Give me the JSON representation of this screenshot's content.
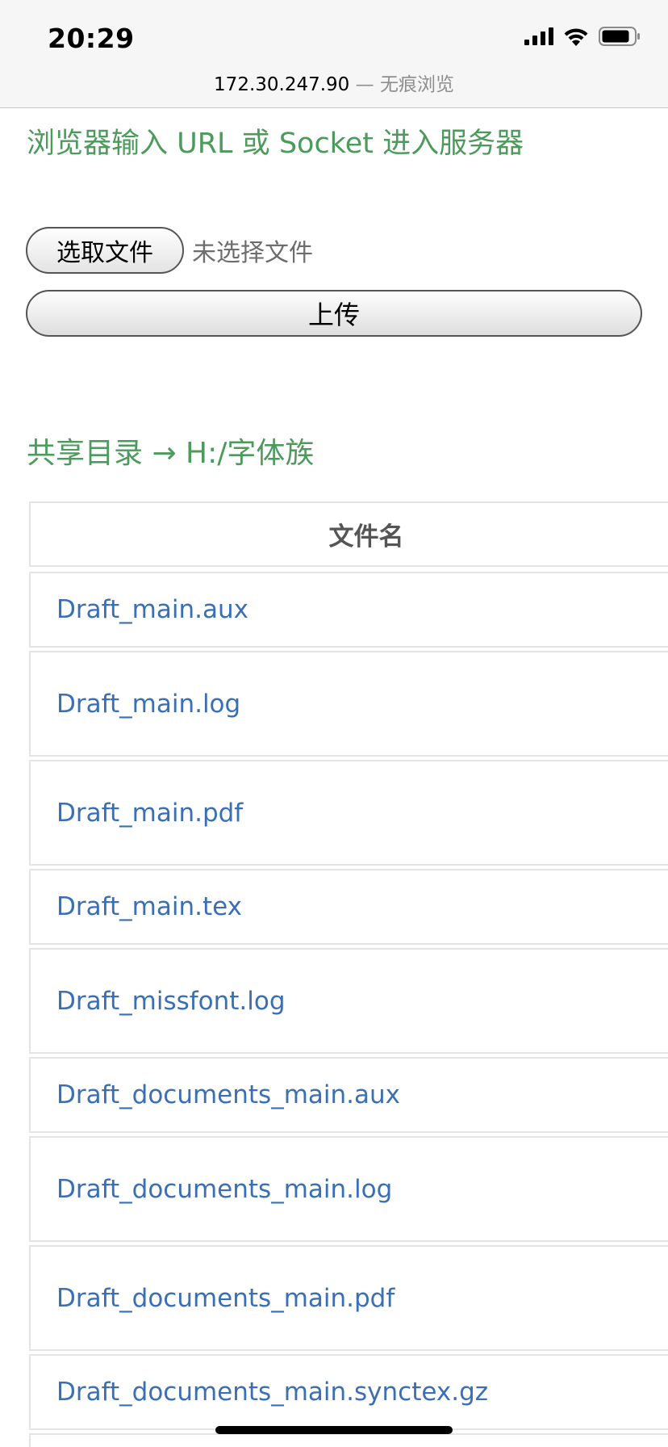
{
  "status_bar": {
    "time": "20:29"
  },
  "address_bar": {
    "host": "172.30.247.90",
    "separator": " — ",
    "mode": "无痕浏览"
  },
  "page": {
    "entry_hint": "浏览器输入 URL 或 Socket 进入服务器",
    "choose_file_label": "选取文件",
    "no_file_text": "未选择文件",
    "upload_label": "上传",
    "share_path": "共享目录 → H:/字体族",
    "table_header": "文件名",
    "files": [
      "Draft_main.aux",
      "Draft_main.log",
      "Draft_main.pdf",
      "Draft_main.tex",
      "Draft_missfont.log",
      "Draft_documents_main.aux",
      "Draft_documents_main.log",
      "Draft_documents_main.pdf",
      "Draft_documents_main.synctex.gz"
    ]
  },
  "colors": {
    "heading_green": "#4c9a5c",
    "link_blue": "#3a6fb5",
    "border_gray": "#e4e4e4"
  }
}
